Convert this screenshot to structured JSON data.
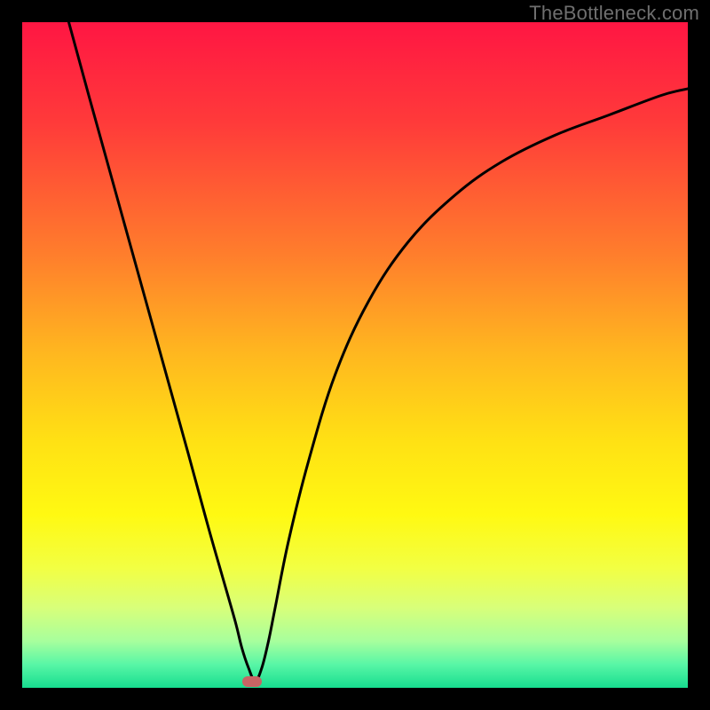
{
  "watermark": "TheBottleneck.com",
  "chart_data": {
    "type": "line",
    "title": "",
    "xlabel": "",
    "ylabel": "",
    "x_range": [
      0,
      100
    ],
    "y_range": [
      0,
      100
    ],
    "series": [
      {
        "name": "bottleneck-curve",
        "x": [
          7,
          10,
          15,
          20,
          25,
          28,
          30,
          32,
          33,
          34,
          35,
          36,
          37,
          38,
          40,
          43,
          47,
          52,
          58,
          65,
          72,
          80,
          88,
          96,
          100
        ],
        "y": [
          100,
          89,
          71,
          53,
          35,
          24,
          17,
          10,
          6,
          3,
          1,
          3,
          7,
          12,
          22,
          34,
          47,
          58,
          67,
          74,
          79,
          83,
          86,
          89,
          90
        ]
      }
    ],
    "marker": {
      "x": 34.5,
      "y": 1
    },
    "gradient_stops": [
      {
        "pos": 0.0,
        "color": "#ff1643"
      },
      {
        "pos": 0.15,
        "color": "#ff3a3a"
      },
      {
        "pos": 0.35,
        "color": "#ff7e2c"
      },
      {
        "pos": 0.5,
        "color": "#ffb81f"
      },
      {
        "pos": 0.63,
        "color": "#ffe114"
      },
      {
        "pos": 0.74,
        "color": "#fff912"
      },
      {
        "pos": 0.82,
        "color": "#f2ff43"
      },
      {
        "pos": 0.88,
        "color": "#d8ff7a"
      },
      {
        "pos": 0.93,
        "color": "#a7ff9d"
      },
      {
        "pos": 0.965,
        "color": "#58f6a6"
      },
      {
        "pos": 1.0,
        "color": "#17dd8f"
      }
    ]
  }
}
